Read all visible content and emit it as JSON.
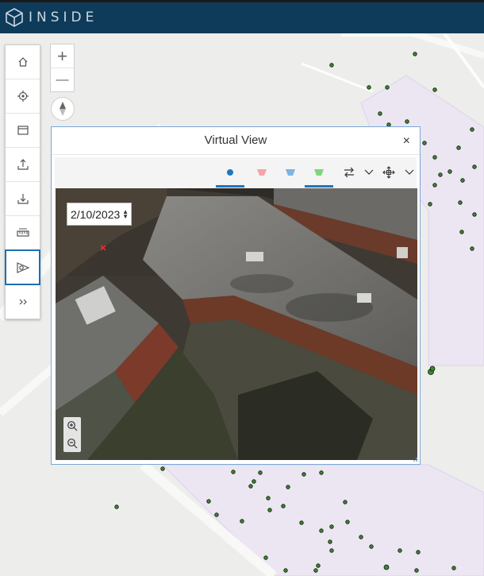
{
  "app": {
    "brand": "INSIDE"
  },
  "toolbar": {
    "items": [
      {
        "name": "home-icon"
      },
      {
        "name": "locate-icon"
      },
      {
        "name": "layers-icon"
      },
      {
        "name": "upload-icon"
      },
      {
        "name": "download-icon"
      },
      {
        "name": "measure-icon"
      },
      {
        "name": "virtual-view-icon",
        "active": true
      },
      {
        "name": "expand-icon"
      }
    ]
  },
  "map_controls": {
    "zoom_in": "+",
    "zoom_out": "—"
  },
  "panel": {
    "title": "Virtual View",
    "close": "×",
    "date": "2/10/2023",
    "tools": [
      {
        "name": "camera-point-icon",
        "color": "#1d78c0",
        "selected": true
      },
      {
        "name": "camera-red-icon",
        "color": "#f4a3a8",
        "selected": false
      },
      {
        "name": "camera-blue-icon",
        "color": "#7cb4e4",
        "selected": false
      },
      {
        "name": "camera-green-icon",
        "color": "#7dd67a",
        "selected": true
      },
      {
        "name": "swap-icon"
      },
      {
        "name": "chevron-down-icon"
      },
      {
        "name": "move-icon"
      },
      {
        "name": "chevron-down-icon"
      }
    ]
  },
  "colors": {
    "header": "#0f3b5a",
    "accent": "#1d78c0",
    "map_bg": "#ededeb",
    "zone": "#ece6f3",
    "point": "#3a8a2a"
  }
}
